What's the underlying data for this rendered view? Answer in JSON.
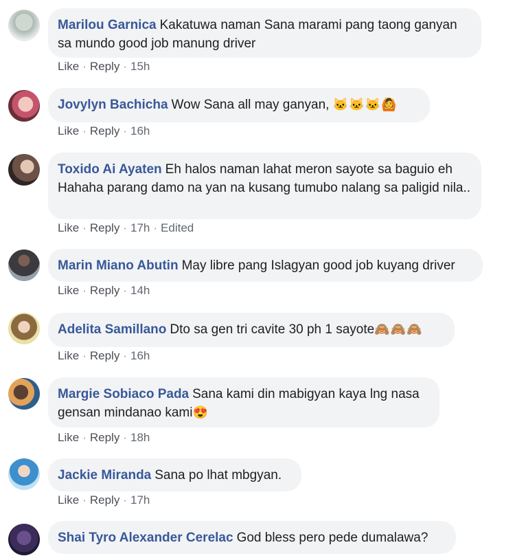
{
  "comments": [
    {
      "author": "Marilou Garnica",
      "text": "Kakatuwa naman Sana marami pang taong ganyan sa mundo good job manung driver",
      "like": "Like",
      "reply": "Reply",
      "time": "15h",
      "edited": "",
      "emoji": ""
    },
    {
      "author": "Jovylyn Bachicha",
      "text": "Wow Sana all may ganyan,",
      "like": "Like",
      "reply": "Reply",
      "time": "16h",
      "edited": "",
      "emoji": "🐱🐱🐱🙆"
    },
    {
      "author": "Toxido Ai Ayaten",
      "text": "Eh halos naman lahat meron sayote sa baguio eh Hahaha parang damo na yan na kusang tumubo nalang sa paligid nila..",
      "like": "Like",
      "reply": "Reply",
      "time": "17h",
      "edited": "Edited",
      "emoji": ""
    },
    {
      "author": "Marin Miano Abutin",
      "text": "May libre pang Islagyan good job kuyang driver",
      "like": "Like",
      "reply": "Reply",
      "time": "14h",
      "edited": "",
      "emoji": ""
    },
    {
      "author": "Adelita Samillano",
      "text": "Dto sa gen tri cavite 30 ph 1 sayote",
      "like": "Like",
      "reply": "Reply",
      "time": "16h",
      "edited": "",
      "emoji": "🙈🙈🙈"
    },
    {
      "author": "Margie Sobiaco Pada",
      "text": "Sana kami din mabigyan kaya lng nasa gensan mindanao kami",
      "like": "Like",
      "reply": "Reply",
      "time": "18h",
      "edited": "",
      "emoji": "😍"
    },
    {
      "author": "Jackie Miranda",
      "text": "Sana po lhat mbgyan.",
      "like": "Like",
      "reply": "Reply",
      "time": "17h",
      "edited": "",
      "emoji": ""
    },
    {
      "author": "Shai Tyro Alexander Cerelac",
      "text": "God bless pero pede dumalawa?",
      "like": "",
      "reply": "",
      "time": "",
      "edited": "",
      "emoji": ""
    }
  ],
  "colors": {
    "author": "#385898",
    "bubble": "#f2f3f5",
    "meta": "#606770"
  }
}
